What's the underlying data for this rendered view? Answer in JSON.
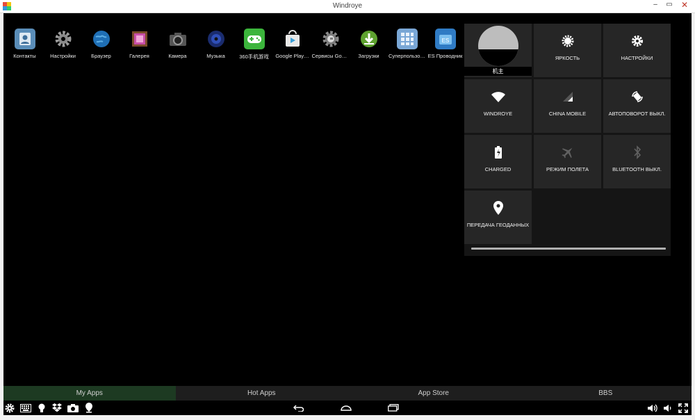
{
  "window": {
    "title": "Windroye",
    "minimize": "–",
    "restore": "▭",
    "close": "✕"
  },
  "home_apps": [
    {
      "label": "Контакты",
      "icon": "contacts-icon"
    },
    {
      "label": "Настройки",
      "icon": "settings-gear-icon"
    },
    {
      "label": "Браузер",
      "icon": "browser-globe-icon"
    },
    {
      "label": "Галерея",
      "icon": "gallery-icon"
    },
    {
      "label": "Камера",
      "icon": "camera-icon"
    },
    {
      "label": "Музыка",
      "icon": "music-icon"
    },
    {
      "label": "360手机游戏",
      "icon": "gamepad-icon"
    },
    {
      "label": "Google Play…",
      "icon": "play-store-icon"
    },
    {
      "label": "Сервисы Goo…",
      "icon": "google-settings-icon"
    },
    {
      "label": "Загрузки",
      "icon": "download-icon"
    },
    {
      "label": "Суперпользо…",
      "icon": "superuser-icon"
    },
    {
      "label": "ES Проводник",
      "icon": "es-explorer-icon"
    }
  ],
  "quick_settings": {
    "user_name": "机主",
    "brightness": "ЯРКОСТЬ",
    "settings": "НАСТРОЙКИ",
    "wifi": "WINDROYE",
    "mobile": "CHINA MOBILE",
    "rotation": "АВТОПОВОРОТ ВЫКЛ.",
    "battery": "CHARGED",
    "airplane": "РЕЖИМ ПОЛЕТА",
    "bluetooth": "BLUETOOTH ВЫКЛ.",
    "location": "ПЕРЕДАЧА ГЕОДАННЫХ"
  },
  "tabs": [
    {
      "label": "My Apps",
      "active": true
    },
    {
      "label": "Hot Apps",
      "active": false
    },
    {
      "label": "App Store",
      "active": false
    },
    {
      "label": "BBS",
      "active": false
    }
  ],
  "colors": {
    "screen_bg": "#000000",
    "tile_bg": "#262626",
    "active_tab": "#1d3a22"
  }
}
